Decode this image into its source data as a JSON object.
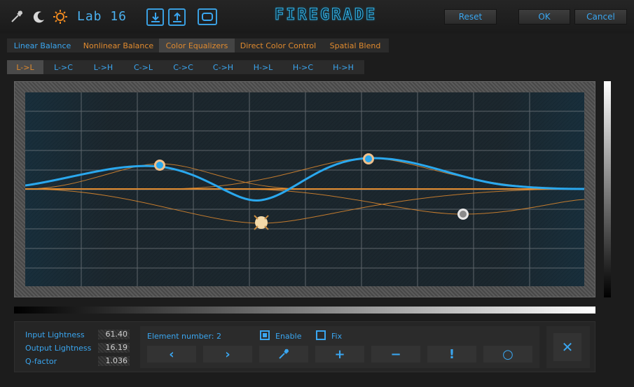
{
  "toolbar": {
    "mode_label": "Lab 16",
    "logo_text": "FIREGRADE",
    "reset_label": "Reset",
    "ok_label": "OK",
    "cancel_label": "Cancel"
  },
  "tabs": [
    {
      "label": "Linear Balance",
      "active": false
    },
    {
      "label": "Nonlinear Balance",
      "active": false
    },
    {
      "label": "Color Equalizers",
      "active": true
    },
    {
      "label": "Direct Color Control",
      "active": false
    },
    {
      "label": "Spatial Blend",
      "active": false
    }
  ],
  "subtabs": [
    {
      "label": "L->L",
      "active": true
    },
    {
      "label": "L->C",
      "active": false
    },
    {
      "label": "L->H",
      "active": false
    },
    {
      "label": "C->L",
      "active": false
    },
    {
      "label": "C->C",
      "active": false
    },
    {
      "label": "C->H",
      "active": false
    },
    {
      "label": "H->L",
      "active": false
    },
    {
      "label": "H->C",
      "active": false
    },
    {
      "label": "H->H",
      "active": false
    }
  ],
  "params": {
    "input_lightness_label": "Input Lightness",
    "input_lightness_value": "61.40",
    "output_lightness_label": "Output Lightness",
    "output_lightness_value": "16.19",
    "q_factor_label": "Q-factor",
    "q_factor_value": "1.036"
  },
  "element": {
    "number_label": "Element number: 2",
    "enable_label": "Enable",
    "enable_checked": true,
    "fix_label": "Fix",
    "fix_checked": false
  },
  "colors": {
    "accent_blue": "#3aa6f0",
    "accent_orange": "#e08a2e",
    "curve_blue": "#2aa8ee",
    "curve_orange": "#e08a2e"
  },
  "icons": {
    "eyedropper": "eyedropper-icon",
    "moon": "moon-icon",
    "sun": "sun-icon",
    "download": "download-icon",
    "upload": "upload-icon",
    "preview": "preview-icon",
    "prev": "chevron-left-icon",
    "next": "chevron-right-icon",
    "picker": "eyedropper-icon",
    "add": "plus-icon",
    "remove": "minus-icon",
    "exclamation": "exclamation-icon",
    "circle": "circle-icon",
    "close": "close-icon"
  }
}
